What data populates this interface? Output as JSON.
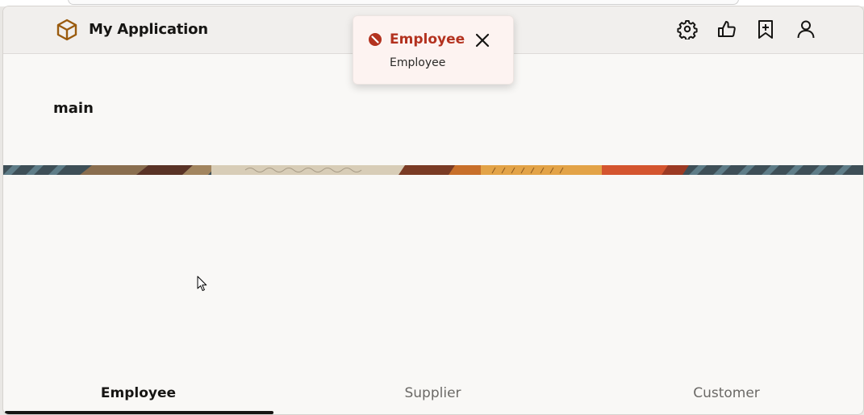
{
  "app": {
    "title": "My Application",
    "logo_icon": "box-icon",
    "brand_color": "#9a5b0e"
  },
  "toolbar": {
    "icons": [
      "settings-icon",
      "thumbs-up-icon",
      "bookmark-add-icon",
      "user-icon"
    ]
  },
  "main": {
    "heading": "main"
  },
  "toast": {
    "severity": "error",
    "title": "Employee",
    "message": "Employee",
    "color": "#b3321f"
  },
  "tabs": [
    {
      "label": "Employee",
      "selected": true
    },
    {
      "label": "Supplier",
      "selected": false
    },
    {
      "label": "Customer",
      "selected": false
    }
  ]
}
